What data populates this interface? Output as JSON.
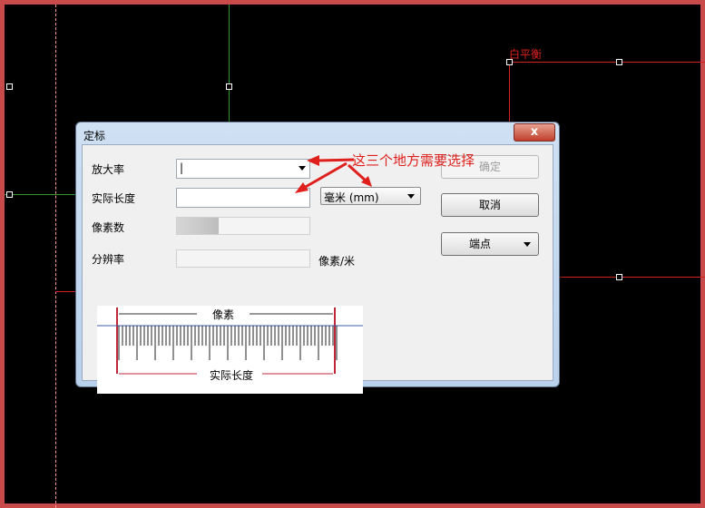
{
  "canvas": {
    "object_label": "白平衡",
    "colors": {
      "background": "#000000",
      "frame": "#c84a4a",
      "green_line": "#2e9a2e",
      "red_line": "#d02020"
    }
  },
  "dialog": {
    "title": "定标",
    "close_glyph": "x",
    "fields": {
      "magnification_label": "放大率",
      "magnification_value": "|",
      "actual_length_label": "实际长度",
      "actual_length_value": "",
      "unit_value": "毫米 (mm)",
      "pixel_count_label": "像素数",
      "resolution_label": "分辨率",
      "resolution_unit": "像素/米"
    },
    "buttons": {
      "ok": "确定",
      "cancel": "取消",
      "endpoint": "端点"
    },
    "diagram": {
      "top_label": "像素",
      "bottom_label": "实际长度"
    },
    "annotation": "这三个地方需要选择"
  }
}
